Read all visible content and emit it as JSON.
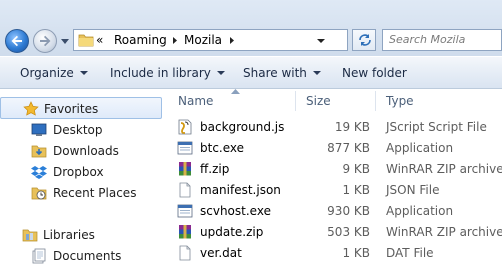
{
  "address_bar": {
    "overflow_glyph": "«",
    "breadcrumbs": [
      "Roaming",
      "Mozila"
    ],
    "search_placeholder": "Search Mozila"
  },
  "toolbar": {
    "organize": "Organize",
    "include_in_library": "Include in library",
    "share_with": "Share with",
    "new_folder": "New folder"
  },
  "nav": {
    "favorites": {
      "label": "Favorites",
      "items": [
        "Desktop",
        "Downloads",
        "Dropbox",
        "Recent Places"
      ]
    },
    "libraries": {
      "label": "Libraries",
      "items": [
        "Documents"
      ]
    }
  },
  "columns": {
    "name": "Name",
    "size": "Size",
    "type": "Type"
  },
  "files": [
    {
      "name": "background.js",
      "size": "19 KB",
      "type": "JScript Script File",
      "icon": "js-script-icon"
    },
    {
      "name": "btc.exe",
      "size": "877 KB",
      "type": "Application",
      "icon": "exe-icon"
    },
    {
      "name": "ff.zip",
      "size": "9 KB",
      "type": "WinRAR ZIP archive",
      "icon": "winrar-icon"
    },
    {
      "name": "manifest.json",
      "size": "1 KB",
      "type": "JSON File",
      "icon": "blank-file-icon"
    },
    {
      "name": "scvhost.exe",
      "size": "930 KB",
      "type": "Application",
      "icon": "exe-icon"
    },
    {
      "name": "update.zip",
      "size": "503 KB",
      "type": "WinRAR ZIP archive",
      "icon": "winrar-icon"
    },
    {
      "name": "ver.dat",
      "size": "1 KB",
      "type": "DAT File",
      "icon": "blank-file-icon"
    }
  ]
}
